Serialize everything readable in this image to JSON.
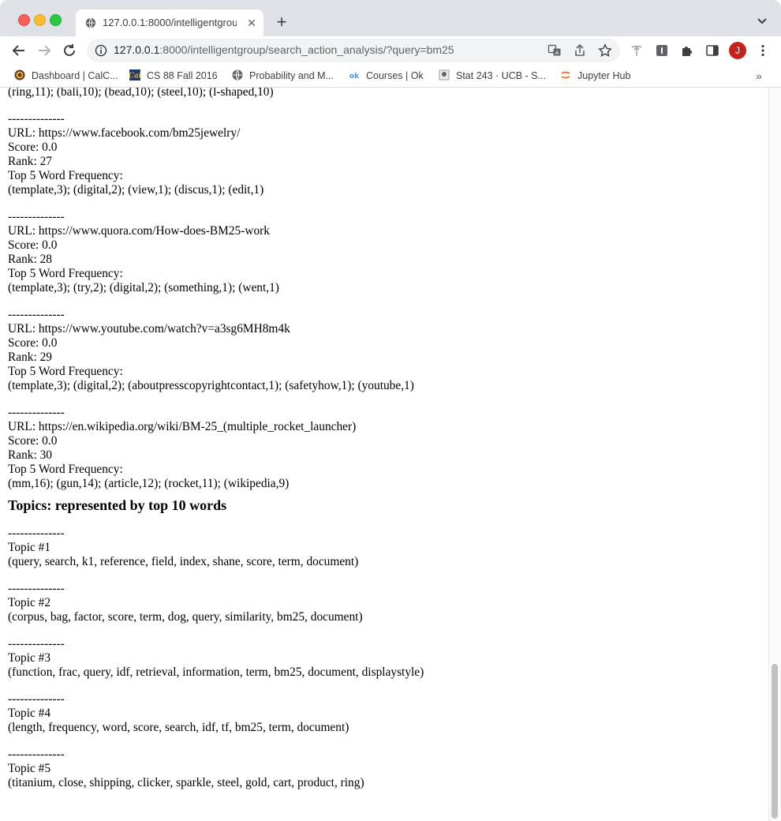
{
  "browser": {
    "tab_title": "127.0.0.1:8000/intelligentgroup",
    "url_host": "127.0.0.1",
    "url_rest": ":8000/intelligentgroup/search_action_analysis/?query=bm25",
    "avatar_letter": "J",
    "bookmarks": [
      {
        "label": "Dashboard | CalC...",
        "icon": "calcentral-icon"
      },
      {
        "label": "CS 88 Fall 2016",
        "icon": "cal-icon"
      },
      {
        "label": "Probability and M...",
        "icon": "globe-icon"
      },
      {
        "label": "Courses | Ok",
        "icon": "ok-icon"
      },
      {
        "label": "Stat 243 · UCB - S...",
        "icon": "stat-icon"
      },
      {
        "label": "Jupyter Hub",
        "icon": "jupyter-icon"
      }
    ]
  },
  "page": {
    "partial_top_line": "(ring,11); (bali,10); (bead,10); (steel,10); (l-shaped,10)",
    "separator": "--------------",
    "results": [
      {
        "url": "URL: https://www.facebook.com/bm25jewelry/",
        "score": "Score: 0.0",
        "rank": "Rank: 27",
        "freq_label": "Top 5 Word Frequency:",
        "freq": "(template,3); (digital,2); (view,1); (discus,1); (edit,1)"
      },
      {
        "url": "URL: https://www.quora.com/How-does-BM25-work",
        "score": "Score: 0.0",
        "rank": "Rank: 28",
        "freq_label": "Top 5 Word Frequency:",
        "freq": "(template,3); (try,2); (digital,2); (something,1); (went,1)"
      },
      {
        "url": "URL: https://www.youtube.com/watch?v=a3sg6MH8m4k",
        "score": "Score: 0.0",
        "rank": "Rank: 29",
        "freq_label": "Top 5 Word Frequency:",
        "freq": "(template,3); (digital,2); (aboutpresscopyrightcontact,1); (safetyhow,1); (youtube,1)"
      },
      {
        "url": "URL: https://en.wikipedia.org/wiki/BM-25_(multiple_rocket_launcher)",
        "score": "Score: 0.0",
        "rank": "Rank: 30",
        "freq_label": "Top 5 Word Frequency:",
        "freq": "(mm,16); (gun,14); (article,12); (rocket,11); (wikipedia,9)"
      }
    ],
    "topics_heading": "Topics: represented by top 10 words",
    "topics": [
      {
        "label": "Topic #1",
        "words": "(query, search, k1, reference, field, index, shane, score, term, document)"
      },
      {
        "label": "Topic #2",
        "words": "(corpus, bag, factor, score, term, dog, query, similarity, bm25, document)"
      },
      {
        "label": "Topic #3",
        "words": "(function, frac, query, idf, retrieval, information, term, bm25, document, displaystyle)"
      },
      {
        "label": "Topic #4",
        "words": "(length, frequency, word, score, search, idf, tf, bm25, term, document)"
      },
      {
        "label": "Topic #5",
        "words": "(titanium, close, shipping, clicker, sparkle, steel, gold, cart, product, ring)"
      }
    ]
  }
}
